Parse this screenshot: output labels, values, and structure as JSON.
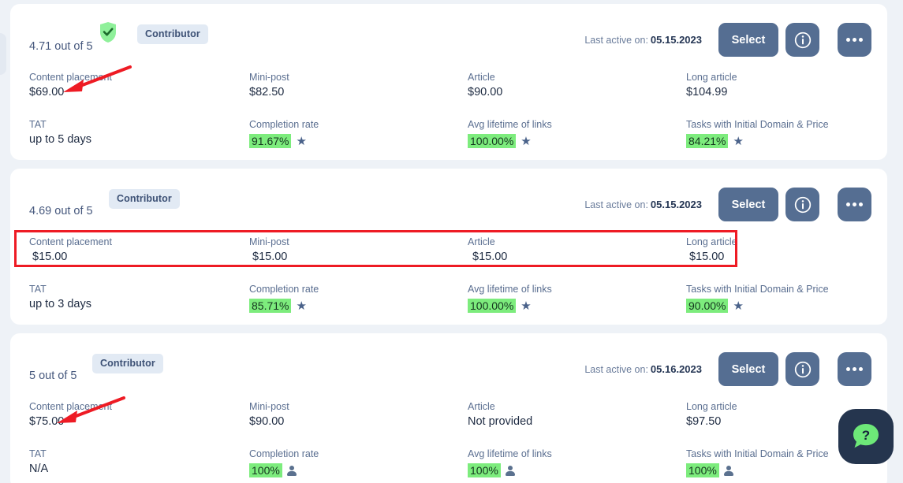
{
  "labels": {
    "content_placement": "Content placement",
    "mini_post": "Mini-post",
    "article": "Article",
    "long_article": "Long article",
    "tat": "TAT",
    "completion_rate": "Completion rate",
    "avg_lifetime": "Avg lifetime of links",
    "tasks_initial": "Tasks with Initial Domain & Price",
    "last_active": "Last active on:",
    "select": "Select"
  },
  "icons": {
    "verified_shield": "verified-shield-icon",
    "info": "info-icon",
    "more": "more-options-icon",
    "star": "★",
    "person": "person-icon",
    "chat_question": "?"
  },
  "colors": {
    "page_background": "#eef2f7",
    "card_background": "#ffffff",
    "button_primary": "#556e92",
    "chip_background": "#e2eaf4",
    "chip_text": "#3d5175",
    "highlight_green": "#7dec7d",
    "annotation_red": "#ee1b24",
    "chat_dark": "#25354e",
    "chat_green": "#6de878"
  },
  "cards": [
    {
      "verified": true,
      "chip": "Contributor",
      "rating": "4.71 out of 5",
      "last_active_date": "05.15.2023",
      "prices": [
        {
          "label": "Content placement",
          "value": "$69.00"
        },
        {
          "label": "Mini-post",
          "value": "$82.50"
        },
        {
          "label": "Article",
          "value": "$90.00"
        },
        {
          "label": "Long article",
          "value": "$104.99"
        }
      ],
      "stats": [
        {
          "label": "TAT",
          "value": "up to 5 days",
          "type": "text"
        },
        {
          "label": "Completion rate",
          "value": "91.67%",
          "type": "pct",
          "icon": "star"
        },
        {
          "label": "Avg lifetime of links",
          "value": "100.00%",
          "type": "pct",
          "icon": "star"
        },
        {
          "label": "Tasks with Initial Domain & Price",
          "value": "84.21%",
          "type": "pct",
          "icon": "star"
        }
      ]
    },
    {
      "verified": false,
      "chip": "Contributor",
      "rating": "4.69 out of 5",
      "last_active_date": "05.15.2023",
      "prices": [
        {
          "label": "Content placement",
          "value": "$15.00"
        },
        {
          "label": "Mini-post",
          "value": "$15.00"
        },
        {
          "label": "Article",
          "value": "$15.00"
        },
        {
          "label": "Long article",
          "value": "$15.00"
        }
      ],
      "stats": [
        {
          "label": "TAT",
          "value": "up to 3 days",
          "type": "text"
        },
        {
          "label": "Completion rate",
          "value": "85.71%",
          "type": "pct",
          "icon": "star"
        },
        {
          "label": "Avg lifetime of links",
          "value": "100.00%",
          "type": "pct",
          "icon": "star"
        },
        {
          "label": "Tasks with Initial Domain & Price",
          "value": "90.00%",
          "type": "pct",
          "icon": "star"
        }
      ]
    },
    {
      "verified": false,
      "chip": "Contributor",
      "rating": "5 out of 5",
      "last_active_date": "05.16.2023",
      "prices": [
        {
          "label": "Content placement",
          "value": "$75.00"
        },
        {
          "label": "Mini-post",
          "value": "$90.00"
        },
        {
          "label": "Article",
          "value": "Not provided"
        },
        {
          "label": "Long article",
          "value": "$97.50"
        }
      ],
      "stats": [
        {
          "label": "TAT",
          "value": "N/A",
          "type": "text"
        },
        {
          "label": "Completion rate",
          "value": "100%",
          "type": "pct",
          "icon": "person"
        },
        {
          "label": "Avg lifetime of links",
          "value": "100%",
          "type": "pct",
          "icon": "person"
        },
        {
          "label": "Tasks with Initial Domain & Price",
          "value": "100%",
          "type": "pct",
          "icon": "person"
        }
      ]
    }
  ],
  "annotations": {
    "highlight_box_card": 2,
    "arrows": [
      {
        "points_to": "card-1 Content placement price"
      },
      {
        "points_to": "card-3 Content placement price"
      }
    ]
  }
}
